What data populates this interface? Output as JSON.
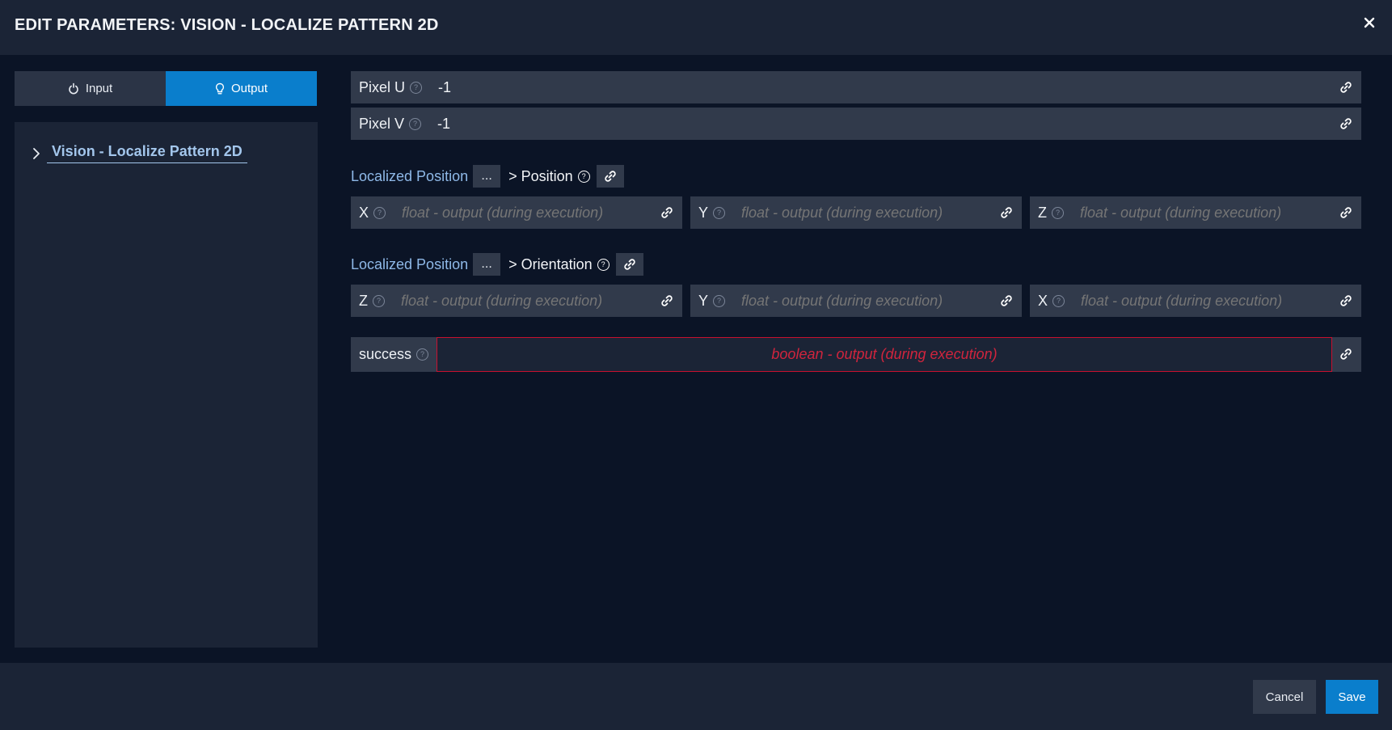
{
  "header": {
    "title": "EDIT PARAMETERS: VISION - LOCALIZE PATTERN 2D"
  },
  "tabs": [
    {
      "label": "Input",
      "icon": "power-icon"
    },
    {
      "label": "Output",
      "icon": "lightbulb-icon"
    }
  ],
  "tree": {
    "node_label": "Vision - Localize Pattern 2D"
  },
  "pixel_u": {
    "label": "Pixel U",
    "value": "-1"
  },
  "pixel_v": {
    "label": "Pixel V",
    "value": "-1"
  },
  "position_section": {
    "prefix": "Localized Position",
    "dots": "...",
    "suffix": "> Position",
    "fields": [
      {
        "label": "X",
        "placeholder": "float - output (during execution)"
      },
      {
        "label": "Y",
        "placeholder": "float - output (during execution)"
      },
      {
        "label": "Z",
        "placeholder": "float - output (during execution)"
      }
    ]
  },
  "orientation_section": {
    "prefix": "Localized Position",
    "dots": "...",
    "suffix": "> Orientation",
    "fields": [
      {
        "label": "Z",
        "placeholder": "float - output (during execution)"
      },
      {
        "label": "Y",
        "placeholder": "float - output (during execution)"
      },
      {
        "label": "X",
        "placeholder": "float - output (during execution)"
      }
    ]
  },
  "success": {
    "label": "success",
    "placeholder": "boolean - output (during execution)"
  },
  "footer": {
    "cancel_label": "Cancel",
    "save_label": "Save"
  },
  "colors": {
    "accent": "#0a7ecc",
    "error": "#c8102e",
    "link_text": "#8fb9e8"
  }
}
